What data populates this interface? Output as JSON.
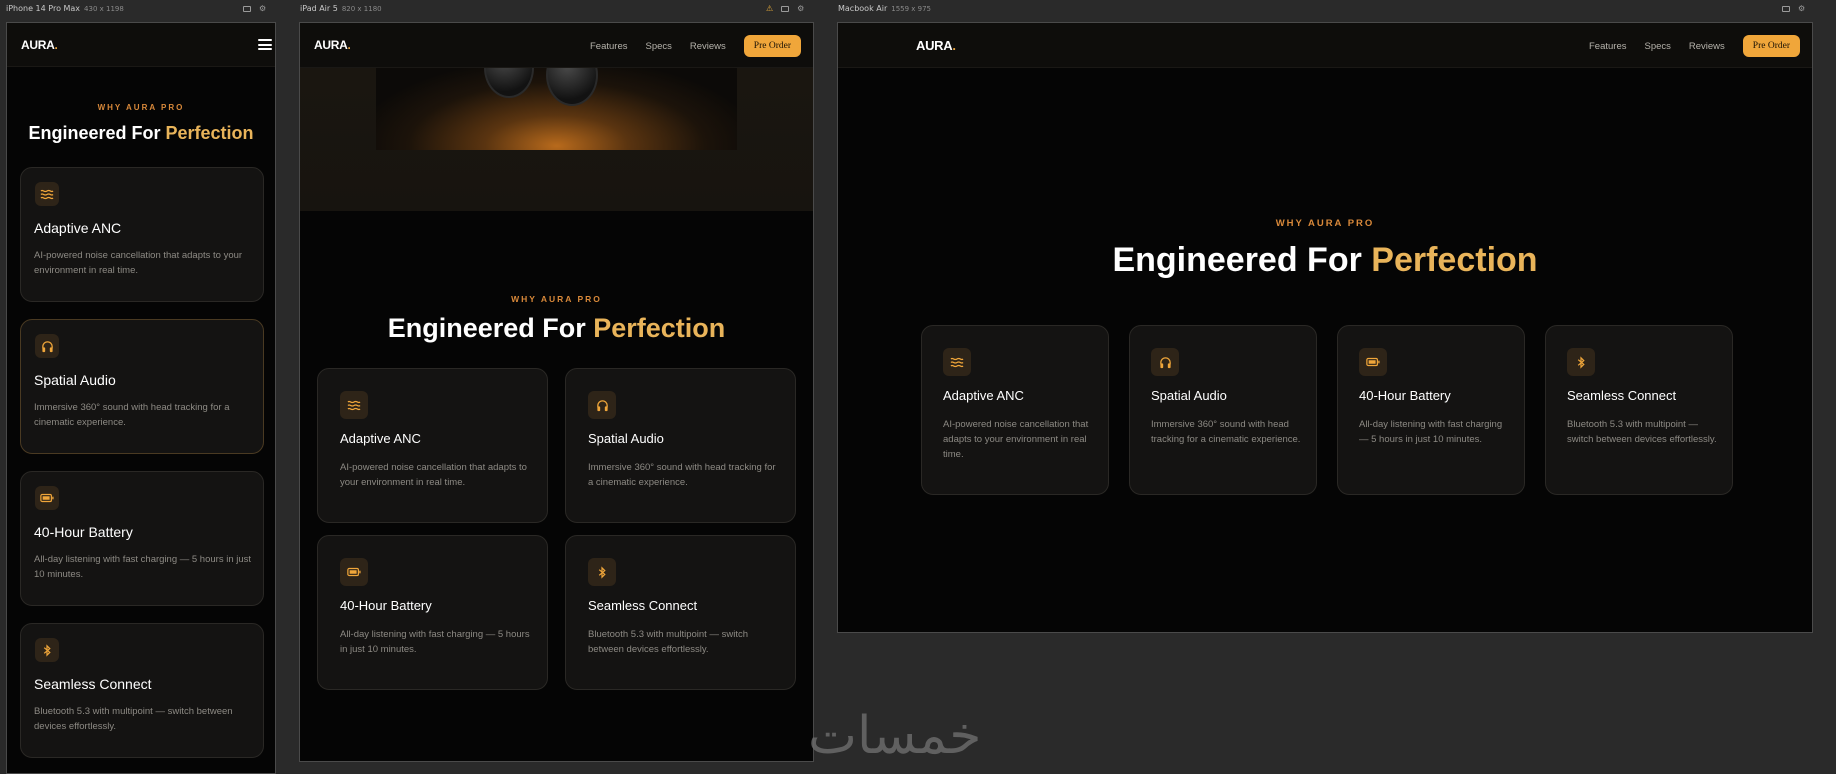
{
  "frames": {
    "mobile": {
      "name": "iPhone 14 Pro Max",
      "size": "430 x 1198"
    },
    "tablet": {
      "name": "iPad Air 5",
      "size": "820 x 1180"
    },
    "desktop": {
      "name": "Macbook Air",
      "size": "1559 x 975"
    }
  },
  "site": {
    "logo": "AURA",
    "logo_dot": ".",
    "nav": {
      "features": "Features",
      "specs": "Specs",
      "reviews": "Reviews",
      "cta": "Pre Order"
    },
    "section": {
      "eyebrow": "WHY AURA PRO",
      "heading_main": "Engineered For ",
      "heading_accent": "Perfection"
    },
    "features": [
      {
        "icon": "waves-icon",
        "title": "Adaptive ANC",
        "desc": "AI-powered noise cancellation that adapts to your environment in real time."
      },
      {
        "icon": "headphones-icon",
        "title": "Spatial Audio",
        "desc": "Immersive 360° sound with head tracking for a cinematic experience."
      },
      {
        "icon": "battery-icon",
        "title": "40-Hour Battery",
        "desc": "All-day listening with fast charging — 5 hours in just 10 minutes."
      },
      {
        "icon": "bluetooth-icon",
        "title": "Seamless Connect",
        "desc": "Bluetooth 5.3 with multipoint — switch between devices effortlessly."
      }
    ]
  },
  "colors": {
    "accent": "#f0a63a",
    "accent_text": "#e9b45a",
    "eyebrow": "#d9893a",
    "bg": "#050505",
    "card": "#141312"
  },
  "watermark": "خمسات"
}
